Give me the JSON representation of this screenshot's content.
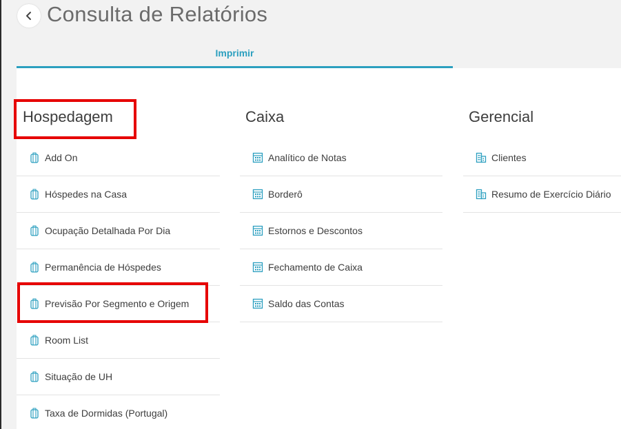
{
  "header": {
    "title": "Consulta de Relatórios",
    "back_icon": "chevron-left-icon"
  },
  "tabs": [
    {
      "label": "Imprimir",
      "active": true
    }
  ],
  "accent_color": "#2b9fbf",
  "highlight_color": "#e60000",
  "sections": {
    "hospedagem": {
      "title": "Hospedagem",
      "icon": "luggage-icon",
      "items": [
        "Add On",
        "Hóspedes na Casa",
        "Ocupação Detalhada Por Dia",
        "Permanência de Hóspedes",
        "Previsão Por Segmento e Origem",
        "Room List",
        "Situação de UH",
        "Taxa de Dormidas (Portugal)"
      ]
    },
    "caixa": {
      "title": "Caixa",
      "icon": "calculator-icon",
      "items": [
        "Analítico de Notas",
        "Borderô",
        "Estornos e Descontos",
        "Fechamento de Caixa",
        "Saldo das Contas"
      ]
    },
    "gerencial": {
      "title": "Gerencial",
      "icon": "building-icon",
      "items": [
        "Clientes",
        "Resumo de Exercício Diário"
      ]
    }
  }
}
